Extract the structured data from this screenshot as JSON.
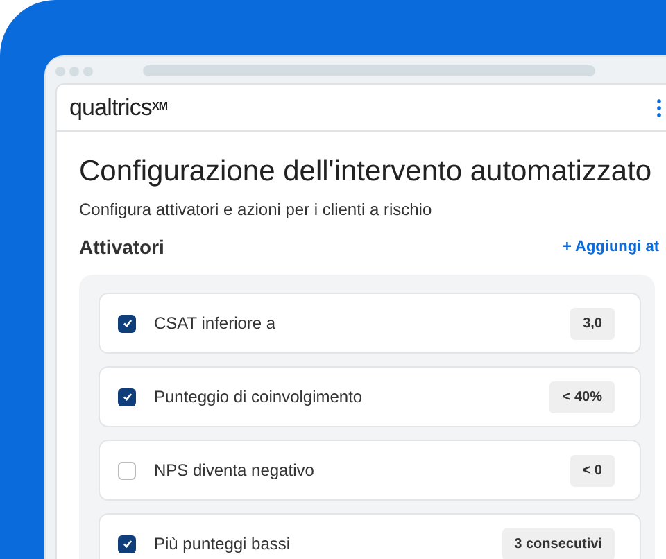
{
  "app": {
    "logo": "qualtrics$^{XM}$"
  },
  "page": {
    "title": "Configurazione dell'intervento automatizzato",
    "subtitle": "Configura attivatori e azioni per i clienti a rischio"
  },
  "section": {
    "title": "Attivatori",
    "add_link": "+ Aggiungi at"
  },
  "triggers": [
    {
      "label": "CSAT inferiore a",
      "checked": true,
      "value": "3,0"
    },
    {
      "label": "Punteggio di coinvolgimento",
      "checked": true,
      "value": "< 40%"
    },
    {
      "label": "NPS diventa negativo",
      "checked": false,
      "value": "< 0"
    },
    {
      "label": "Più punteggi bassi",
      "checked": true,
      "value": "3 consecutivi"
    }
  ]
}
